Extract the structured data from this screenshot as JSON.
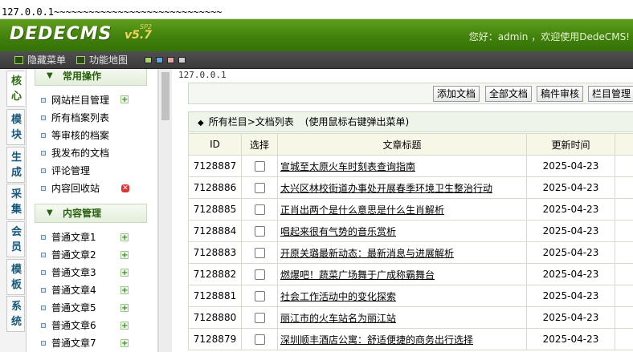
{
  "topstrip": {
    "text": "127.0.0.1~~~~~~~~~~~~~~~~~~~~~~~~~~~~~"
  },
  "header": {
    "logo": "DEDECMS",
    "version": "v5.7",
    "version_sup": "SP2",
    "welcome": "您好：admin ，欢迎使用DedeCMS!"
  },
  "toolbar": {
    "hide_menu": "隐藏菜单",
    "function_map": "功能地图",
    "swatches": [
      "#a8d56a",
      "#5aa6e0",
      "#e8a2a2",
      "#d0d0d0"
    ]
  },
  "vtabs": [
    "核心",
    "模块",
    "生成",
    "采集",
    "会员",
    "模板",
    "系统"
  ],
  "menu": {
    "group1": "常用操作",
    "group1_items": [
      "网站栏目管理",
      "所有档案列表",
      "等审核的档案",
      "我发布的文档",
      "评论管理",
      "内容回收站"
    ],
    "group2": "内容管理",
    "group2_items": [
      "普通文章1",
      "普通文章2",
      "普通文章3",
      "普通文章4",
      "普通文章5",
      "普通文章6",
      "普通文章7"
    ]
  },
  "content": {
    "crumb": "127.0.0.1",
    "buttons": [
      "添加文档",
      "全部文档",
      "稿件审核",
      "栏目管理"
    ],
    "list_title": "所有栏目>文档列表",
    "list_hint": "(使用鼠标右键弹出菜单)",
    "columns": [
      "ID",
      "选择",
      "文章标题",
      "更新时间",
      ""
    ],
    "rows": [
      {
        "id": "7128887",
        "title": "宣城至太原火车时刻表查询指南",
        "date": "2025-04-23"
      },
      {
        "id": "7128886",
        "title": "太兴区林校街道办事处开展春季环境卫生整治行动",
        "date": "2025-04-23"
      },
      {
        "id": "7128885",
        "title": "正肖出两个是什么意思是什么生肖解析",
        "date": "2025-04-23"
      },
      {
        "id": "7128884",
        "title": "唱起来很有气势的音乐赏析",
        "date": "2025-04-23"
      },
      {
        "id": "7128883",
        "title": "开原关璐最新动态：最新消息与进展解析",
        "date": "2025-04-23"
      },
      {
        "id": "7128882",
        "title": "燃爆吧！蔬菜广场舞于广成称霸舞台",
        "date": "2025-04-23"
      },
      {
        "id": "7128881",
        "title": "社会工作活动中的变化探索",
        "date": "2025-04-23"
      },
      {
        "id": "7128880",
        "title": "丽江市的火车站名为丽江站",
        "date": "2025-04-23"
      },
      {
        "id": "7128879",
        "title": "深圳顺丰酒店公寓：舒适便捷的商务出行选择",
        "date": "2025-04-23"
      }
    ]
  }
}
